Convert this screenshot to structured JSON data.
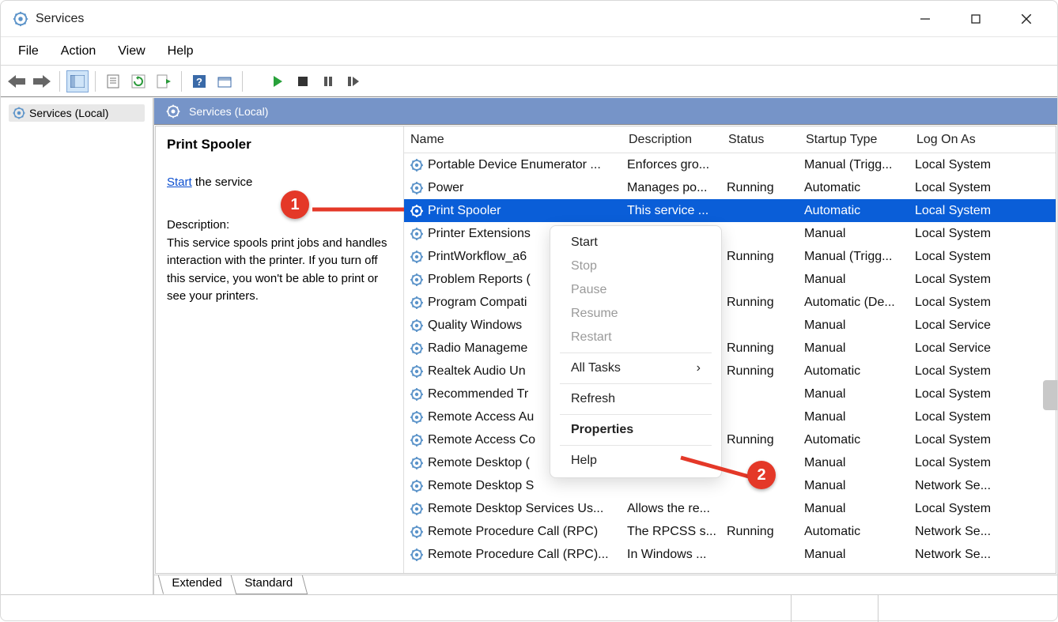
{
  "window": {
    "title": "Services"
  },
  "menubar": [
    "File",
    "Action",
    "View",
    "Help"
  ],
  "left_tree": {
    "label": "Services (Local)"
  },
  "panel_header": "Services (Local)",
  "detail": {
    "title": "Print Spooler",
    "start_link": "Start",
    "start_suffix": " the service",
    "desc_label": "Description:",
    "desc_text": "This service spools print jobs and handles interaction with the printer. If you turn off this service, you won't be able to print or see your printers."
  },
  "columns": [
    "Name",
    "Description",
    "Status",
    "Startup Type",
    "Log On As"
  ],
  "services": [
    {
      "name": "Portable Device Enumerator ...",
      "desc": "Enforces gro...",
      "status": "",
      "startup": "Manual (Trigg...",
      "logon": "Local System",
      "selected": false
    },
    {
      "name": "Power",
      "desc": "Manages po...",
      "status": "Running",
      "startup": "Automatic",
      "logon": "Local System",
      "selected": false
    },
    {
      "name": "Print Spooler",
      "desc": "This service ...",
      "status": "",
      "startup": "Automatic",
      "logon": "Local System",
      "selected": true
    },
    {
      "name": "Printer Extensions",
      "desc": "",
      "status": "",
      "startup": "Manual",
      "logon": "Local System",
      "selected": false,
      "name_trunc": "Printer Extensions"
    },
    {
      "name": "PrintWorkflow_a6",
      "desc": "",
      "status": "Running",
      "startup": "Manual (Trigg...",
      "logon": "Local System",
      "selected": false
    },
    {
      "name": "Problem Reports (",
      "desc": "",
      "status": "",
      "startup": "Manual",
      "logon": "Local System",
      "selected": false
    },
    {
      "name": "Program Compati",
      "desc": "",
      "status": "Running",
      "startup": "Automatic (De...",
      "logon": "Local System",
      "selected": false
    },
    {
      "name": "Quality Windows",
      "desc": "",
      "status": "",
      "startup": "Manual",
      "logon": "Local Service",
      "selected": false
    },
    {
      "name": "Radio Manageme",
      "desc": "",
      "status": "Running",
      "startup": "Manual",
      "logon": "Local Service",
      "selected": false
    },
    {
      "name": "Realtek Audio Un",
      "desc": "",
      "status": "Running",
      "startup": "Automatic",
      "logon": "Local System",
      "selected": false
    },
    {
      "name": "Recommended Tr",
      "desc": "",
      "status": "",
      "startup": "Manual",
      "logon": "Local System",
      "selected": false
    },
    {
      "name": "Remote Access Au",
      "desc": "",
      "status": "",
      "startup": "Manual",
      "logon": "Local System",
      "selected": false
    },
    {
      "name": "Remote Access Co",
      "desc": "",
      "status": "Running",
      "startup": "Automatic",
      "logon": "Local System",
      "selected": false
    },
    {
      "name": "Remote Desktop (",
      "desc": "",
      "status": "",
      "startup": "Manual",
      "logon": "Local System",
      "selected": false
    },
    {
      "name": "Remote Desktop S",
      "desc": "",
      "status": "",
      "startup": "Manual",
      "logon": "Network Se...",
      "selected": false
    },
    {
      "name": "Remote Desktop Services Us...",
      "desc": "Allows the re...",
      "status": "",
      "startup": "Manual",
      "logon": "Local System",
      "selected": false
    },
    {
      "name": "Remote Procedure Call (RPC)",
      "desc": "The RPCSS s...",
      "status": "Running",
      "startup": "Automatic",
      "logon": "Network Se...",
      "selected": false
    },
    {
      "name": "Remote Procedure Call (RPC)...",
      "desc": "In Windows ...",
      "status": "",
      "startup": "Manual",
      "logon": "Network Se...",
      "selected": false
    }
  ],
  "context_menu": [
    {
      "label": "Start",
      "enabled": true
    },
    {
      "label": "Stop",
      "enabled": false
    },
    {
      "label": "Pause",
      "enabled": false
    },
    {
      "label": "Resume",
      "enabled": false
    },
    {
      "label": "Restart",
      "enabled": false
    },
    {
      "sep": true
    },
    {
      "label": "All Tasks",
      "enabled": true,
      "submenu": true
    },
    {
      "sep": true
    },
    {
      "label": "Refresh",
      "enabled": true
    },
    {
      "sep": true
    },
    {
      "label": "Properties",
      "enabled": true,
      "bold": true
    },
    {
      "sep": true
    },
    {
      "label": "Help",
      "enabled": true
    }
  ],
  "tabs": [
    "Extended",
    "Standard"
  ],
  "annotations": {
    "1": "1",
    "2": "2"
  }
}
